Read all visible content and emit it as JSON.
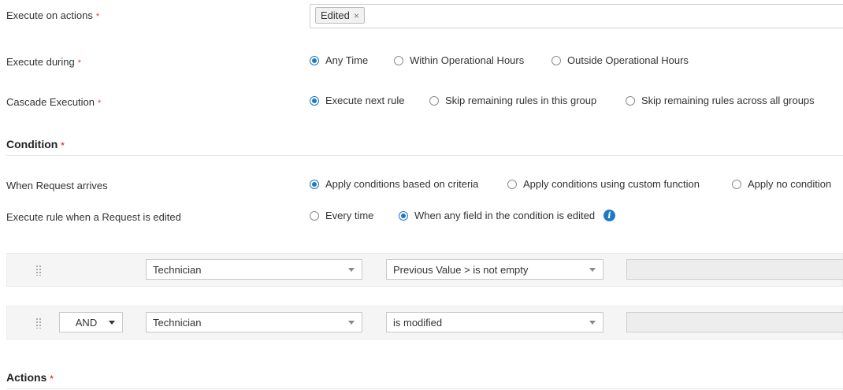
{
  "execute_on_actions": {
    "label": "Execute on actions",
    "required_mark": "*",
    "selected_tags": [
      "Edited"
    ],
    "tag_remove_glyph": "×"
  },
  "execute_during": {
    "label": "Execute during",
    "required_mark": "*",
    "options": [
      "Any Time",
      "Within Operational Hours",
      "Outside Operational Hours"
    ],
    "selected": "Any Time"
  },
  "cascade_execution": {
    "label": "Cascade Execution",
    "required_mark": "*",
    "options": [
      "Execute next rule",
      "Skip remaining rules in this group",
      "Skip remaining rules across all groups"
    ],
    "selected": "Execute next rule"
  },
  "condition_section": {
    "title": "Condition",
    "required_mark": "*"
  },
  "when_request_arrives": {
    "label": "When Request arrives",
    "options": [
      "Apply conditions based on criteria",
      "Apply conditions using custom function",
      "Apply no condition"
    ],
    "selected": "Apply conditions based on criteria"
  },
  "execute_when_edited": {
    "label": "Execute rule when a Request is edited",
    "options": [
      "Every time",
      "When any field in the condition is edited"
    ],
    "selected": "When any field in the condition is edited",
    "info_icon_glyph": "i"
  },
  "condition_rows": [
    {
      "operator": "",
      "field": "Technician",
      "criteria": "Previous Value > is not empty",
      "value": ""
    },
    {
      "operator": "AND",
      "field": "Technician",
      "criteria": "is modified",
      "value": ""
    }
  ],
  "actions_section": {
    "title": "Actions",
    "required_mark": "*"
  },
  "colors": {
    "accent": "#1f7ac4",
    "required": "#e53935",
    "panel_bg": "#f5f5f5"
  },
  "icons": {
    "drag_handle": "drag-handle-icon",
    "dropdown": "chevron-down-icon",
    "info": "info-icon",
    "remove_tag": "close-icon"
  }
}
